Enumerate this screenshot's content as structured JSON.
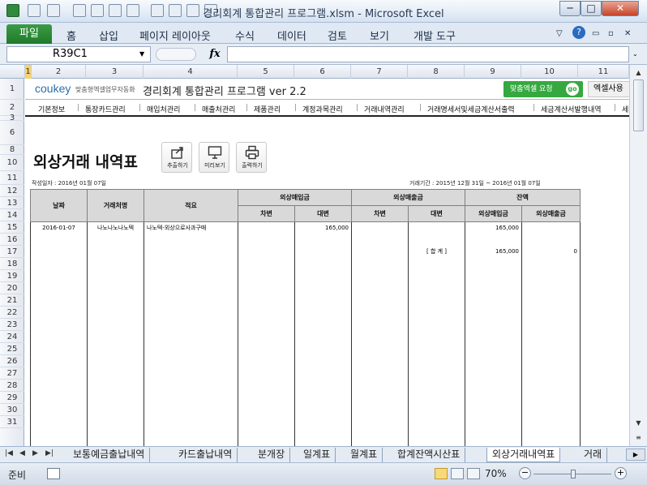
{
  "window": {
    "title": "경리회계 통합관리 프로그램.xlsm - Microsoft Excel",
    "buttons": {
      "minimize": "─",
      "maximize": "□",
      "close": "✕"
    }
  },
  "ribbon": {
    "file_tab": "파일",
    "tabs": [
      "홈",
      "삽입",
      "페이지 레이아웃",
      "수식",
      "데이터",
      "검토",
      "보기",
      "개발 도구"
    ]
  },
  "formula_bar": {
    "name_box": "R39C1",
    "fx": "fx",
    "value": ""
  },
  "column_headers": [
    "1",
    "2",
    "3",
    "4",
    "5",
    "6",
    "7",
    "8",
    "9",
    "10",
    "11"
  ],
  "row_headers": [
    "1",
    "2",
    "3",
    "6",
    "8",
    "10",
    "11",
    "12",
    "13",
    "14",
    "15",
    "16",
    "17",
    "18",
    "19",
    "20",
    "21",
    "22",
    "23",
    "24",
    "25",
    "26",
    "27",
    "28",
    "29",
    "30",
    "31"
  ],
  "brand": {
    "logo": "coukey",
    "logo_sub": "맞춤형엑셀업무자동화",
    "program_title": "경리회계 통합관리 프로그램 ver 2.2",
    "request_button": "맞춤엑셀 요청",
    "go_badge": "go",
    "excel_use_button": "엑셀사용"
  },
  "menu": [
    "기본정보",
    "통장카드관리",
    "매입처관리",
    "매출처관리",
    "제품관리",
    "계정과목관리",
    "거래내역관리",
    "거래명세서및세금계산서출력",
    "세금계산서발행내역",
    "세"
  ],
  "report": {
    "title": "외상거래 내역표",
    "tools": [
      {
        "label": "추출하기",
        "icon": "export-icon"
      },
      {
        "label": "미리보기",
        "icon": "monitor-icon"
      },
      {
        "label": "출력하기",
        "icon": "printer-icon"
      }
    ],
    "created_label": "작성일자 : 2016년 01월 07일",
    "period_label": "거래기간 : 2015년 12월 31일 ~ 2016년 01월 07일"
  },
  "table": {
    "headers_top": [
      "날짜",
      "거래처명",
      "적요",
      "외상매입금",
      "외상매출금",
      "잔액"
    ],
    "headers_sub": [
      "차변",
      "대변",
      "차변",
      "대변",
      "외상매입금",
      "외상매출금"
    ],
    "rows": [
      [
        "2016-01-07",
        "나노나노나노텍",
        "나노텍-외상으로사과구매",
        "",
        "165,000",
        "",
        "",
        "165,000",
        ""
      ],
      [
        "",
        "",
        "",
        "",
        "",
        "",
        "",
        "",
        ""
      ],
      [
        "",
        "",
        "",
        "",
        "",
        "",
        "[ 합   계 ]",
        "165,000",
        "0"
      ],
      [
        "",
        "",
        "",
        "",
        "",
        "",
        "",
        "",
        ""
      ],
      [
        "",
        "",
        "",
        "",
        "",
        "",
        "",
        "",
        ""
      ],
      [
        "",
        "",
        "",
        "",
        "",
        "",
        "",
        "",
        ""
      ],
      [
        "",
        "",
        "",
        "",
        "",
        "",
        "",
        "",
        ""
      ],
      [
        "",
        "",
        "",
        "",
        "",
        "",
        "",
        "",
        ""
      ],
      [
        "",
        "",
        "",
        "",
        "",
        "",
        "",
        "",
        ""
      ],
      [
        "",
        "",
        "",
        "",
        "",
        "",
        "",
        "",
        ""
      ],
      [
        "",
        "",
        "",
        "",
        "",
        "",
        "",
        "",
        ""
      ],
      [
        "",
        "",
        "",
        "",
        "",
        "",
        "",
        "",
        ""
      ],
      [
        "",
        "",
        "",
        "",
        "",
        "",
        "",
        "",
        ""
      ],
      [
        "",
        "",
        "",
        "",
        "",
        "",
        "",
        "",
        ""
      ],
      [
        "",
        "",
        "",
        "",
        "",
        "",
        "",
        "",
        ""
      ],
      [
        "",
        "",
        "",
        "",
        "",
        "",
        "",
        "",
        ""
      ],
      [
        "",
        "",
        "",
        "",
        "",
        "",
        "",
        "",
        ""
      ],
      [
        "",
        "",
        "",
        "",
        "",
        "",
        "",
        "",
        ""
      ],
      [
        "",
        "",
        "",
        "",
        "",
        "",
        "",
        "",
        ""
      ],
      [
        "",
        "",
        "",
        "",
        "",
        "",
        "",
        "",
        ""
      ]
    ]
  },
  "sheet_tabs": [
    "보통예금출납내역",
    "카드출납내역",
    "분개장",
    "일계표",
    "월계표",
    "합계잔액시산표",
    "외상거래내역표",
    "거래"
  ],
  "active_sheet_index": 6,
  "status": {
    "ready": "준비",
    "zoom": "70%"
  },
  "colors": {
    "file_tab": "#1f7a2a",
    "request_button": "#35a93f",
    "header_fill": "#d9d9d9"
  }
}
